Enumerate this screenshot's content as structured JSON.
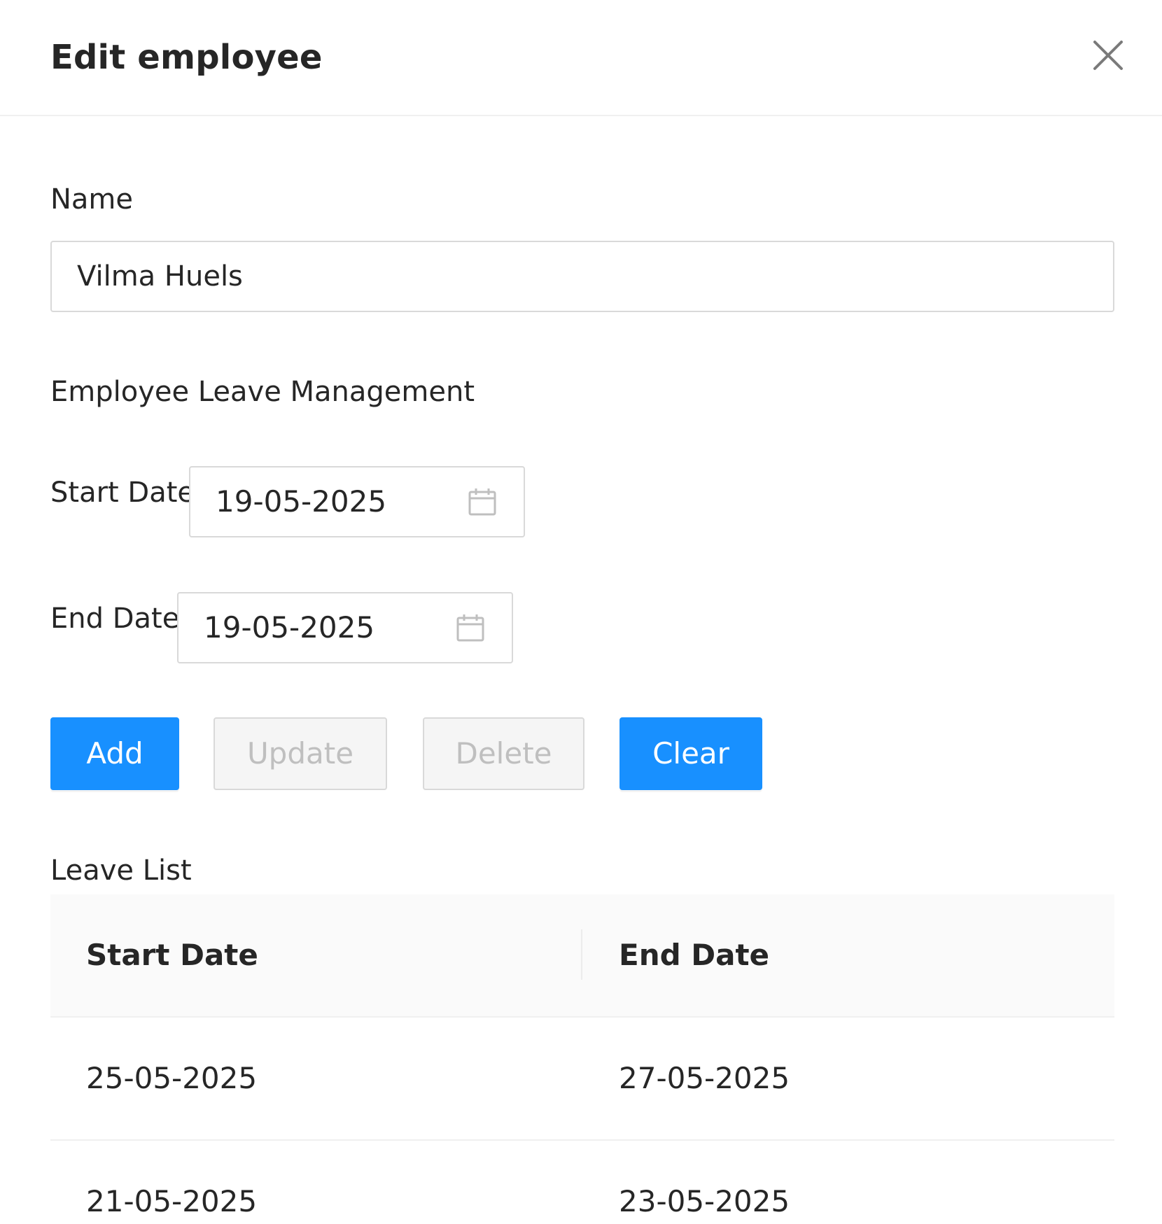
{
  "dialog": {
    "title": "Edit employee",
    "close_icon": "close-icon"
  },
  "form": {
    "name_label": "Name",
    "name_value": "Vilma Huels",
    "section_title": "Employee Leave Management",
    "start_date_label": "Start Date",
    "start_date_value": "19-05-2025",
    "end_date_label": "End Date",
    "end_date_value": "19-05-2025",
    "calendar_icon": "calendar-icon"
  },
  "actions": {
    "add": "Add",
    "update": "Update",
    "delete": "Delete",
    "clear": "Clear",
    "primary_color": "#1890ff",
    "disabled_text_color": "#bfbfbf"
  },
  "leave_list": {
    "title": "Leave List",
    "columns": [
      "Start Date",
      "End Date"
    ],
    "rows": [
      [
        "25-05-2025",
        "27-05-2025"
      ],
      [
        "21-05-2025",
        "23-05-2025"
      ]
    ]
  }
}
